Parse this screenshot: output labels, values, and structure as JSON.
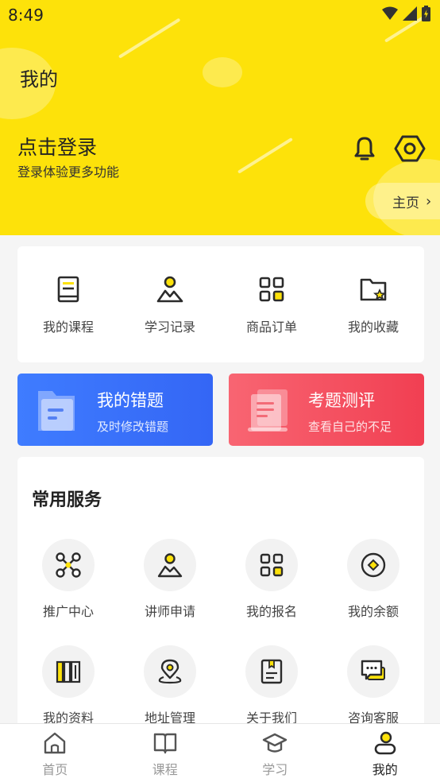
{
  "status_bar": {
    "time": "8:49"
  },
  "header": {
    "title": "我的",
    "login_title": "点击登录",
    "login_subtitle": "登录体验更多功能",
    "home_label": "主页",
    "home_chevron": "›"
  },
  "quick_links": [
    {
      "label": "我的课程",
      "icon": "book-icon"
    },
    {
      "label": "学习记录",
      "icon": "user-landscape-icon"
    },
    {
      "label": "商品订单",
      "icon": "grid-icon"
    },
    {
      "label": "我的收藏",
      "icon": "folder-star-icon"
    }
  ],
  "promos": {
    "mistakes": {
      "title": "我的错题",
      "subtitle": "及时修改错题"
    },
    "exam": {
      "title": "考题测评",
      "subtitle": "查看自己的不足"
    }
  },
  "services": {
    "title": "常用服务",
    "items": [
      {
        "label": "推广中心",
        "icon": "share-nodes-icon"
      },
      {
        "label": "讲师申请",
        "icon": "user-landscape-icon"
      },
      {
        "label": "我的报名",
        "icon": "grid-icon"
      },
      {
        "label": "我的余额",
        "icon": "coin-icon"
      },
      {
        "label": "我的资料",
        "icon": "library-icon"
      },
      {
        "label": "地址管理",
        "icon": "location-pin-icon"
      },
      {
        "label": "关于我们",
        "icon": "document-icon"
      },
      {
        "label": "咨询客服",
        "icon": "chat-icon"
      }
    ]
  },
  "tabbar": [
    {
      "label": "首页",
      "icon": "home-icon",
      "active": false
    },
    {
      "label": "课程",
      "icon": "open-book-icon",
      "active": false
    },
    {
      "label": "学习",
      "icon": "graduation-cap-icon",
      "active": false
    },
    {
      "label": "我的",
      "icon": "profile-icon",
      "active": true
    }
  ],
  "colors": {
    "header_bg": "#fde20a",
    "accent_yellow": "#fde20a",
    "icon_dark": "#2b2b2b",
    "promo_blue": "#3f7cff",
    "promo_red": "#f13f52"
  }
}
